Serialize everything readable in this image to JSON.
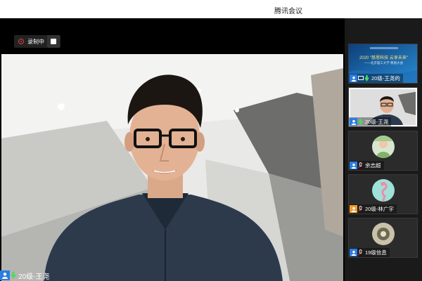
{
  "window": {
    "title": "腾讯会议"
  },
  "recording": {
    "label": "录制中"
  },
  "main_speaker": {
    "name": "20级-王尧"
  },
  "sidebar": {
    "tiles": [
      {
        "name": "20级-王尧的",
        "banner_year": "2020 \"慈恩科技 云享未来\"",
        "banner_sub": "——北京理工大学 慈恩大会"
      },
      {
        "name": "20级-王尧"
      },
      {
        "name": "余志超"
      },
      {
        "name": "20级-林广宇"
      },
      {
        "name": "19级信息"
      }
    ]
  },
  "colors": {
    "user_icon": "#2a7de1",
    "user_icon_alt": "#f39c2b",
    "record": "#e04040"
  }
}
